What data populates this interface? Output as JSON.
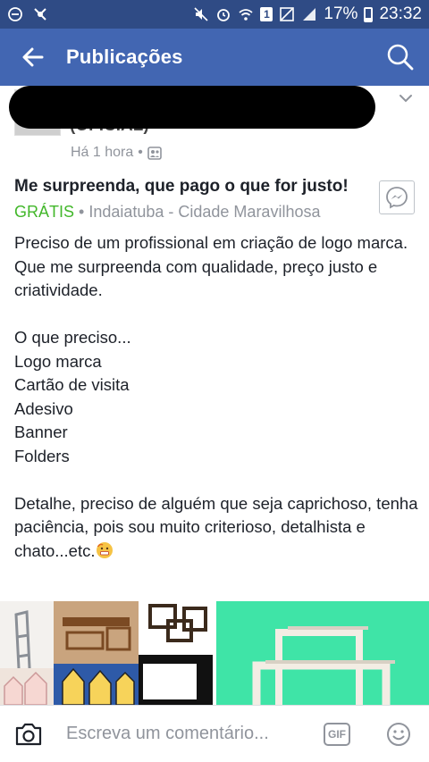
{
  "status_bar": {
    "battery": "17%",
    "time": "23:32",
    "sim_badge": "1"
  },
  "app_bar": {
    "title": "Publicações"
  },
  "post": {
    "author": "(OFICIAL)",
    "time": "Há 1 hora",
    "separator": "•"
  },
  "listing": {
    "title": "Me surpreenda, que pago o que for justo!",
    "price": "GRÁTIS",
    "location": " • Indaiatuba - Cidade Maravilhosa"
  },
  "body": {
    "text": "Preciso de um profissional em criação de logo marca.\nQue me surpreenda com qualidade, preço justo e criatividade.\n\nO que preciso...\nLogo marca\nCartão de visita\nAdesivo\nBanner\nFolders\n\nDetalhe, preciso de alguém que seja caprichoso, tenha paciência, pois sou muito criterioso, detalhista e chato...etc."
  },
  "comment_bar": {
    "placeholder": "Escreva um comentário...",
    "gif_label": "GIF"
  },
  "colors": {
    "app_bar": "#4266b2",
    "status_bar": "#2f4b85",
    "price_green": "#42b72a",
    "secondary_text": "#90949c"
  },
  "icons": [
    "back-arrow-icon",
    "search-icon",
    "chevron-down-icon",
    "friends-audience-icon",
    "messenger-icon",
    "camera-icon",
    "gif-icon",
    "smiley-icon",
    "grimacing-emoji-icon"
  ]
}
